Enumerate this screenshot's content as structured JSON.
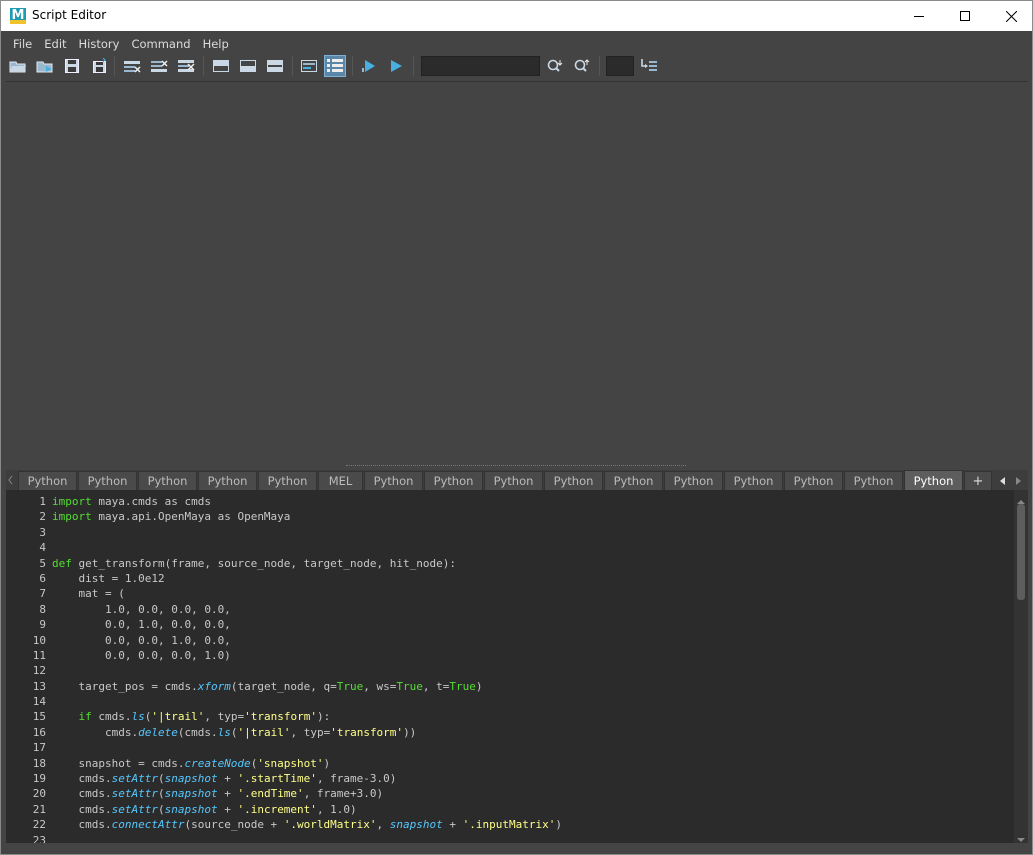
{
  "window": {
    "title": "Script Editor",
    "logo_letter": "M",
    "minimize_icon": "minimize-icon",
    "maximize_icon": "maximize-icon",
    "close_icon": "close-icon"
  },
  "menu": {
    "items": [
      "File",
      "Edit",
      "History",
      "Command",
      "Help"
    ]
  },
  "toolbar": {
    "buttons": [
      "open-script-icon",
      "source-script-icon",
      "save-script-icon",
      "save-script-to-shelf-icon",
      "clear-history-icon",
      "clear-input-icon",
      "clear-all-icon",
      "show-history-icon",
      "show-input-icon",
      "show-both-icon",
      "echo-all-commands-icon",
      "show-line-numbers-icon",
      "execute-selected-icon",
      "execute-all-icon",
      "search-down-icon",
      "search-up-icon",
      "goto-line-icon"
    ],
    "search_value": "",
    "line_field_value": "",
    "active_button": "show-line-numbers-icon",
    "accent_color": "#5a86a8"
  },
  "tabs": {
    "items": [
      "Python",
      "Python",
      "Python",
      "Python",
      "Python",
      "MEL",
      "Python",
      "Python",
      "Python",
      "Python",
      "Python",
      "Python",
      "Python",
      "Python",
      "Python",
      "Python"
    ],
    "selected_index": 15,
    "add_label": "+"
  },
  "editor": {
    "line_numbers": [
      "1",
      "2",
      "3",
      "4",
      "5",
      "6",
      "7",
      "8",
      "9",
      "10",
      "11",
      "12",
      "13",
      "14",
      "15",
      "16",
      "17",
      "18",
      "19",
      "20",
      "21",
      "22",
      "23"
    ],
    "colors": {
      "keyword": "#55dd33",
      "string": "#ffff88",
      "function": "#55c8ff",
      "text": "#c8c8c8",
      "background": "#2b2b2b"
    },
    "lines": [
      [
        [
          "kw",
          "import"
        ],
        [
          "t",
          " maya.cmds as cmds"
        ]
      ],
      [
        [
          "kw",
          "import"
        ],
        [
          "t",
          " maya.api.OpenMaya as OpenMaya"
        ]
      ],
      [],
      [],
      [
        [
          "kw",
          "def"
        ],
        [
          "t",
          " get_transform(frame, source_node, target_node, hit_node):"
        ]
      ],
      [
        [
          "t",
          "    dist = 1.0e12"
        ]
      ],
      [
        [
          "t",
          "    mat = ("
        ]
      ],
      [
        [
          "t",
          "        1.0, 0.0, 0.0, 0.0,"
        ]
      ],
      [
        [
          "t",
          "        0.0, 1.0, 0.0, 0.0,"
        ]
      ],
      [
        [
          "t",
          "        0.0, 0.0, 1.0, 0.0,"
        ]
      ],
      [
        [
          "t",
          "        0.0, 0.0, 0.0, 1.0)"
        ]
      ],
      [],
      [
        [
          "t",
          "    target_pos = cmds."
        ],
        [
          "fn",
          "xform"
        ],
        [
          "t",
          "(target_node, q="
        ],
        [
          "kw",
          "True"
        ],
        [
          "t",
          ", ws="
        ],
        [
          "kw",
          "True"
        ],
        [
          "t",
          ", t="
        ],
        [
          "kw",
          "True"
        ],
        [
          "t",
          ")"
        ]
      ],
      [],
      [
        [
          "t",
          "    "
        ],
        [
          "kw",
          "if"
        ],
        [
          "t",
          " cmds."
        ],
        [
          "fn",
          "ls"
        ],
        [
          "t",
          "("
        ],
        [
          "str",
          "'|trail'"
        ],
        [
          "t",
          ", typ="
        ],
        [
          "str",
          "'transform'"
        ],
        [
          "t",
          "):"
        ]
      ],
      [
        [
          "t",
          "        cmds."
        ],
        [
          "fn",
          "delete"
        ],
        [
          "t",
          "(cmds."
        ],
        [
          "fn",
          "ls"
        ],
        [
          "t",
          "("
        ],
        [
          "str",
          "'|trail'"
        ],
        [
          "t",
          ", typ="
        ],
        [
          "str",
          "'transform'"
        ],
        [
          "t",
          "))"
        ]
      ],
      [],
      [
        [
          "t",
          "    snapshot = cmds."
        ],
        [
          "fn",
          "createNode"
        ],
        [
          "t",
          "("
        ],
        [
          "str",
          "'snapshot'"
        ],
        [
          "t",
          ")"
        ]
      ],
      [
        [
          "t",
          "    cmds."
        ],
        [
          "fn",
          "setAttr"
        ],
        [
          "t",
          "("
        ],
        [
          "fn",
          "snapshot"
        ],
        [
          "t",
          " + "
        ],
        [
          "str",
          "'.startTime'"
        ],
        [
          "t",
          ", frame-3.0)"
        ]
      ],
      [
        [
          "t",
          "    cmds."
        ],
        [
          "fn",
          "setAttr"
        ],
        [
          "t",
          "("
        ],
        [
          "fn",
          "snapshot"
        ],
        [
          "t",
          " + "
        ],
        [
          "str",
          "'.endTime'"
        ],
        [
          "t",
          ", frame+3.0)"
        ]
      ],
      [
        [
          "t",
          "    cmds."
        ],
        [
          "fn",
          "setAttr"
        ],
        [
          "t",
          "("
        ],
        [
          "fn",
          "snapshot"
        ],
        [
          "t",
          " + "
        ],
        [
          "str",
          "'.increment'"
        ],
        [
          "t",
          ", 1.0)"
        ]
      ],
      [
        [
          "t",
          "    cmds."
        ],
        [
          "fn",
          "connectAttr"
        ],
        [
          "t",
          "(source_node + "
        ],
        [
          "str",
          "'.worldMatrix'"
        ],
        [
          "t",
          ", "
        ],
        [
          "fn",
          "snapshot"
        ],
        [
          "t",
          " + "
        ],
        [
          "str",
          "'.inputMatrix'"
        ],
        [
          "t",
          ")"
        ]
      ],
      []
    ]
  }
}
